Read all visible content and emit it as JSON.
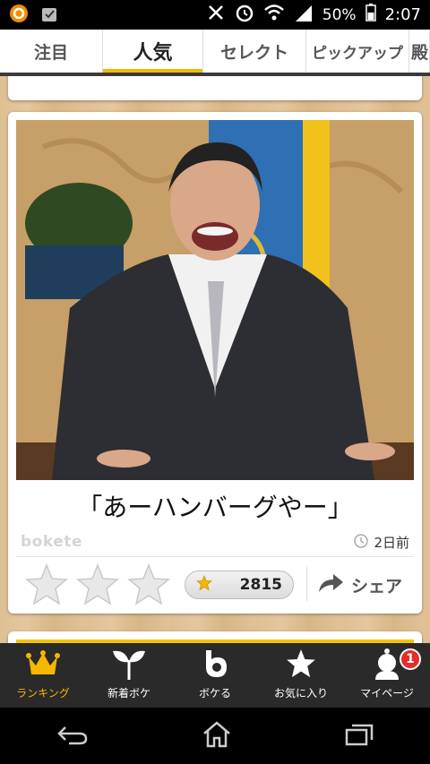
{
  "status_bar": {
    "battery": "50%",
    "time": "2:07"
  },
  "tabs": [
    {
      "label": "注目",
      "active": false
    },
    {
      "label": "人気",
      "active": true
    },
    {
      "label": "セレクト",
      "active": false
    },
    {
      "label": "ピックアップ",
      "active": false
    },
    {
      "label": "殿",
      "active": false
    }
  ],
  "post": {
    "caption": "「あーハンバーグやー」",
    "source_logo": "bokete",
    "time_ago": "2日前",
    "star_count": "2815",
    "share_label": "シェア"
  },
  "bottom_nav": [
    {
      "label": "ランキング",
      "icon": "crown-icon",
      "active": true
    },
    {
      "label": "新着ボケ",
      "icon": "sprout-icon",
      "active": false
    },
    {
      "label": "ボケる",
      "icon": "bokete-b-icon",
      "active": false
    },
    {
      "label": "お気に入り",
      "icon": "star-icon",
      "active": false
    },
    {
      "label": "マイページ",
      "icon": "mypage-avatar-icon",
      "active": false,
      "badge": "1"
    }
  ],
  "colors": {
    "accent": "#f5b700",
    "badge": "#e52b2b",
    "nav_bg": "#2a2a2a"
  }
}
